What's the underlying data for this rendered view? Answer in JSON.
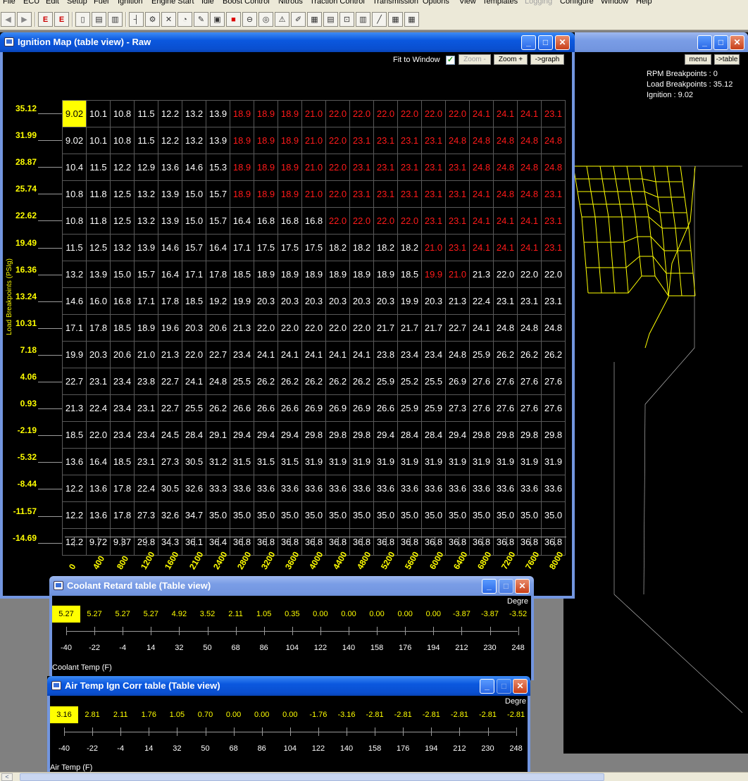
{
  "menu": {
    "items": [
      "File",
      "ECU",
      "Edit",
      "Setup",
      "Fuel",
      "Ignition",
      "Engine Start",
      "Idle",
      "Boost Control",
      "Nitrous",
      "Traction Control",
      "Transmission",
      "Options",
      "View",
      "Templates",
      "Logging",
      "Configure",
      "Window",
      "Help"
    ],
    "disabled": [
      "Logging"
    ]
  },
  "toolbar": {
    "icons": [
      "back-arrow-icon",
      "forward-arrow-icon",
      "ecu-read-icon",
      "ecu-write-icon",
      "new-file-icon",
      "open-file-icon",
      "save-file-icon",
      "tree-icon",
      "engine-icon",
      "tools-icon",
      "gauge-icon",
      "probe-icon",
      "lock-icon",
      "stop-icon",
      "no-entry-icon",
      "dial-icon",
      "warning-icon",
      "wrench-icon",
      "grid-icon",
      "chart-icon",
      "car-icon",
      "graph-icon",
      "line-graph-icon",
      "datalog-icon",
      "report-icon"
    ]
  },
  "ignition_window": {
    "title": "Ignition Map (table view) - Raw",
    "fit_to_window_label": "Fit to Window",
    "zoom_minus_label": "Zoom -",
    "zoom_plus_label": "Zoom +",
    "graph_button_label": "->graph",
    "y_axis_title": "Load Breakpoints (PSIg)",
    "load_breakpoints": [
      "35.12",
      "31.99",
      "28.87",
      "25.74",
      "22.62",
      "19.49",
      "16.36",
      "13.24",
      "10.31",
      "7.18",
      "4.06",
      "0.93",
      "-2.19",
      "-5.32",
      "-8.44",
      "-11.57",
      "-14.69"
    ],
    "rpm_breakpoints": [
      "0",
      "400",
      "800",
      "1200",
      "1600",
      "2100",
      "2400",
      "2800",
      "3200",
      "3600",
      "4000",
      "4400",
      "4800",
      "5200",
      "5600",
      "6000",
      "6400",
      "6800",
      "7200",
      "7600",
      "8000"
    ],
    "rows": [
      [
        "9.02",
        "10.1",
        "10.8",
        "11.5",
        "12.2",
        "13.2",
        "13.9",
        "18.9",
        "18.9",
        "18.9",
        "21.0",
        "22.0",
        "22.0",
        "22.0",
        "22.0",
        "22.0",
        "22.0",
        "24.1",
        "24.1",
        "24.1",
        "23.1"
      ],
      [
        "9.02",
        "10.1",
        "10.8",
        "11.5",
        "12.2",
        "13.2",
        "13.9",
        "18.9",
        "18.9",
        "18.9",
        "21.0",
        "22.0",
        "23.1",
        "23.1",
        "23.1",
        "23.1",
        "24.8",
        "24.8",
        "24.8",
        "24.8",
        "24.8"
      ],
      [
        "10.4",
        "11.5",
        "12.2",
        "12.9",
        "13.6",
        "14.6",
        "15.3",
        "18.9",
        "18.9",
        "18.9",
        "21.0",
        "22.0",
        "23.1",
        "23.1",
        "23.1",
        "23.1",
        "23.1",
        "24.8",
        "24.8",
        "24.8",
        "24.8"
      ],
      [
        "10.8",
        "11.8",
        "12.5",
        "13.2",
        "13.9",
        "15.0",
        "15.7",
        "18.9",
        "18.9",
        "18.9",
        "21.0",
        "22.0",
        "23.1",
        "23.1",
        "23.1",
        "23.1",
        "23.1",
        "24.1",
        "24.8",
        "24.8",
        "23.1"
      ],
      [
        "10.8",
        "11.8",
        "12.5",
        "13.2",
        "13.9",
        "15.0",
        "15.7",
        "16.4",
        "16.8",
        "16.8",
        "16.8",
        "22.0",
        "22.0",
        "22.0",
        "22.0",
        "23.1",
        "23.1",
        "24.1",
        "24.1",
        "24.1",
        "23.1"
      ],
      [
        "11.5",
        "12.5",
        "13.2",
        "13.9",
        "14.6",
        "15.7",
        "16.4",
        "17.1",
        "17.5",
        "17.5",
        "17.5",
        "18.2",
        "18.2",
        "18.2",
        "18.2",
        "21.0",
        "23.1",
        "24.1",
        "24.1",
        "24.1",
        "23.1"
      ],
      [
        "13.2",
        "13.9",
        "15.0",
        "15.7",
        "16.4",
        "17.1",
        "17.8",
        "18.5",
        "18.9",
        "18.9",
        "18.9",
        "18.9",
        "18.9",
        "18.9",
        "18.5",
        "19.9",
        "21.0",
        "21.3",
        "22.0",
        "22.0",
        "22.0"
      ],
      [
        "14.6",
        "16.0",
        "16.8",
        "17.1",
        "17.8",
        "18.5",
        "19.2",
        "19.9",
        "20.3",
        "20.3",
        "20.3",
        "20.3",
        "20.3",
        "20.3",
        "19.9",
        "20.3",
        "21.3",
        "22.4",
        "23.1",
        "23.1",
        "23.1"
      ],
      [
        "17.1",
        "17.8",
        "18.5",
        "18.9",
        "19.6",
        "20.3",
        "20.6",
        "21.3",
        "22.0",
        "22.0",
        "22.0",
        "22.0",
        "22.0",
        "21.7",
        "21.7",
        "21.7",
        "22.7",
        "24.1",
        "24.8",
        "24.8",
        "24.8"
      ],
      [
        "19.9",
        "20.3",
        "20.6",
        "21.0",
        "21.3",
        "22.0",
        "22.7",
        "23.4",
        "24.1",
        "24.1",
        "24.1",
        "24.1",
        "24.1",
        "23.8",
        "23.4",
        "23.4",
        "24.8",
        "25.9",
        "26.2",
        "26.2",
        "26.2"
      ],
      [
        "22.7",
        "23.1",
        "23.4",
        "23.8",
        "22.7",
        "24.1",
        "24.8",
        "25.5",
        "26.2",
        "26.2",
        "26.2",
        "26.2",
        "26.2",
        "25.9",
        "25.2",
        "25.5",
        "26.9",
        "27.6",
        "27.6",
        "27.6",
        "27.6"
      ],
      [
        "21.3",
        "22.4",
        "23.4",
        "23.1",
        "22.7",
        "25.5",
        "26.2",
        "26.6",
        "26.6",
        "26.6",
        "26.9",
        "26.9",
        "26.9",
        "26.6",
        "25.9",
        "25.9",
        "27.3",
        "27.6",
        "27.6",
        "27.6",
        "27.6"
      ],
      [
        "18.5",
        "22.0",
        "23.4",
        "23.4",
        "24.5",
        "28.4",
        "29.1",
        "29.4",
        "29.4",
        "29.4",
        "29.8",
        "29.8",
        "29.8",
        "29.4",
        "28.4",
        "28.4",
        "29.4",
        "29.8",
        "29.8",
        "29.8",
        "29.8"
      ],
      [
        "13.6",
        "16.4",
        "18.5",
        "23.1",
        "27.3",
        "30.5",
        "31.2",
        "31.5",
        "31.5",
        "31.5",
        "31.9",
        "31.9",
        "31.9",
        "31.9",
        "31.9",
        "31.9",
        "31.9",
        "31.9",
        "31.9",
        "31.9",
        "31.9"
      ],
      [
        "12.2",
        "13.6",
        "17.8",
        "22.4",
        "30.5",
        "32.6",
        "33.3",
        "33.6",
        "33.6",
        "33.6",
        "33.6",
        "33.6",
        "33.6",
        "33.6",
        "33.6",
        "33.6",
        "33.6",
        "33.6",
        "33.6",
        "33.6",
        "33.6"
      ],
      [
        "12.2",
        "13.6",
        "17.8",
        "27.3",
        "32.6",
        "34.7",
        "35.0",
        "35.0",
        "35.0",
        "35.0",
        "35.0",
        "35.0",
        "35.0",
        "35.0",
        "35.0",
        "35.0",
        "35.0",
        "35.0",
        "35.0",
        "35.0",
        "35.0"
      ],
      [
        "12.2",
        "9.72",
        "9.37",
        "29.8",
        "34.3",
        "36.1",
        "36.4",
        "36.8",
        "36.8",
        "36.8",
        "36.8",
        "36.8",
        "36.8",
        "36.8",
        "36.8",
        "36.8",
        "36.8",
        "36.8",
        "36.8",
        "36.8",
        "36.8"
      ]
    ],
    "red_cells": [
      [
        0,
        7
      ],
      [
        0,
        8
      ],
      [
        0,
        9
      ],
      [
        0,
        10
      ],
      [
        0,
        11
      ],
      [
        0,
        12
      ],
      [
        0,
        13
      ],
      [
        0,
        14
      ],
      [
        0,
        15
      ],
      [
        0,
        16
      ],
      [
        0,
        17
      ],
      [
        0,
        18
      ],
      [
        0,
        19
      ],
      [
        0,
        20
      ],
      [
        1,
        7
      ],
      [
        1,
        8
      ],
      [
        1,
        9
      ],
      [
        1,
        10
      ],
      [
        1,
        11
      ],
      [
        1,
        12
      ],
      [
        1,
        13
      ],
      [
        1,
        14
      ],
      [
        1,
        15
      ],
      [
        1,
        16
      ],
      [
        1,
        17
      ],
      [
        1,
        18
      ],
      [
        1,
        19
      ],
      [
        1,
        20
      ],
      [
        2,
        7
      ],
      [
        2,
        8
      ],
      [
        2,
        9
      ],
      [
        2,
        10
      ],
      [
        2,
        11
      ],
      [
        2,
        12
      ],
      [
        2,
        13
      ],
      [
        2,
        14
      ],
      [
        2,
        15
      ],
      [
        2,
        16
      ],
      [
        2,
        17
      ],
      [
        2,
        18
      ],
      [
        2,
        19
      ],
      [
        2,
        20
      ],
      [
        3,
        7
      ],
      [
        3,
        8
      ],
      [
        3,
        9
      ],
      [
        3,
        10
      ],
      [
        3,
        11
      ],
      [
        3,
        12
      ],
      [
        3,
        13
      ],
      [
        3,
        14
      ],
      [
        3,
        15
      ],
      [
        3,
        16
      ],
      [
        3,
        17
      ],
      [
        3,
        18
      ],
      [
        3,
        19
      ],
      [
        3,
        20
      ],
      [
        4,
        11
      ],
      [
        4,
        12
      ],
      [
        4,
        13
      ],
      [
        4,
        14
      ],
      [
        4,
        15
      ],
      [
        4,
        16
      ],
      [
        4,
        17
      ],
      [
        4,
        18
      ],
      [
        4,
        19
      ],
      [
        4,
        20
      ],
      [
        5,
        15
      ],
      [
        5,
        16
      ],
      [
        5,
        17
      ],
      [
        5,
        18
      ],
      [
        5,
        19
      ],
      [
        5,
        20
      ],
      [
        6,
        15
      ],
      [
        6,
        16
      ]
    ],
    "selected_cell": [
      0,
      0
    ]
  },
  "graph_window": {
    "menu_label": "menu",
    "table_label": "->table",
    "rpm_info": "RPM Breakpoints : 0",
    "load_info": "Load Breakpoints : 35.12",
    "ign_info": "Ignition : 9.02"
  },
  "coolant_window": {
    "title": "Coolant Retard table (Table view)",
    "unit_label": "Degre",
    "values": [
      "5.27",
      "5.27",
      "5.27",
      "5.27",
      "4.92",
      "3.52",
      "2.11",
      "1.05",
      "0.35",
      "0.00",
      "0.00",
      "0.00",
      "0.00",
      "0.00",
      "-3.87",
      "-3.87",
      "-3.52"
    ],
    "temps": [
      "-40",
      "-22",
      "-4",
      "14",
      "32",
      "50",
      "68",
      "86",
      "104",
      "122",
      "140",
      "158",
      "176",
      "194",
      "212",
      "230",
      "248"
    ],
    "axis_title": "Coolant Temp (F)",
    "selected_index": 0
  },
  "airtemp_window": {
    "title": "Air Temp Ign Corr table (Table view)",
    "unit_label": "Degre",
    "values": [
      "3.16",
      "2.81",
      "2.11",
      "1.76",
      "1.05",
      "0.70",
      "0.00",
      "0.00",
      "0.00",
      "-1.76",
      "-3.16",
      "-2.81",
      "-2.81",
      "-2.81",
      "-2.81",
      "-2.81",
      "-2.81"
    ],
    "temps": [
      "-40",
      "-22",
      "-4",
      "14",
      "32",
      "50",
      "68",
      "86",
      "104",
      "122",
      "140",
      "158",
      "176",
      "194",
      "212",
      "230",
      "248"
    ],
    "axis_title": "Air Temp (F)",
    "selected_index": 0
  },
  "colors": {
    "value_text": "#ffffff",
    "hot_text": "#ff1a1a",
    "selected_bg": "#ffff00",
    "axis_text": "#ffff00",
    "wireframe": "#ffff00",
    "title_active": "#0a4fcf",
    "title_inactive": "#7a9de6"
  }
}
